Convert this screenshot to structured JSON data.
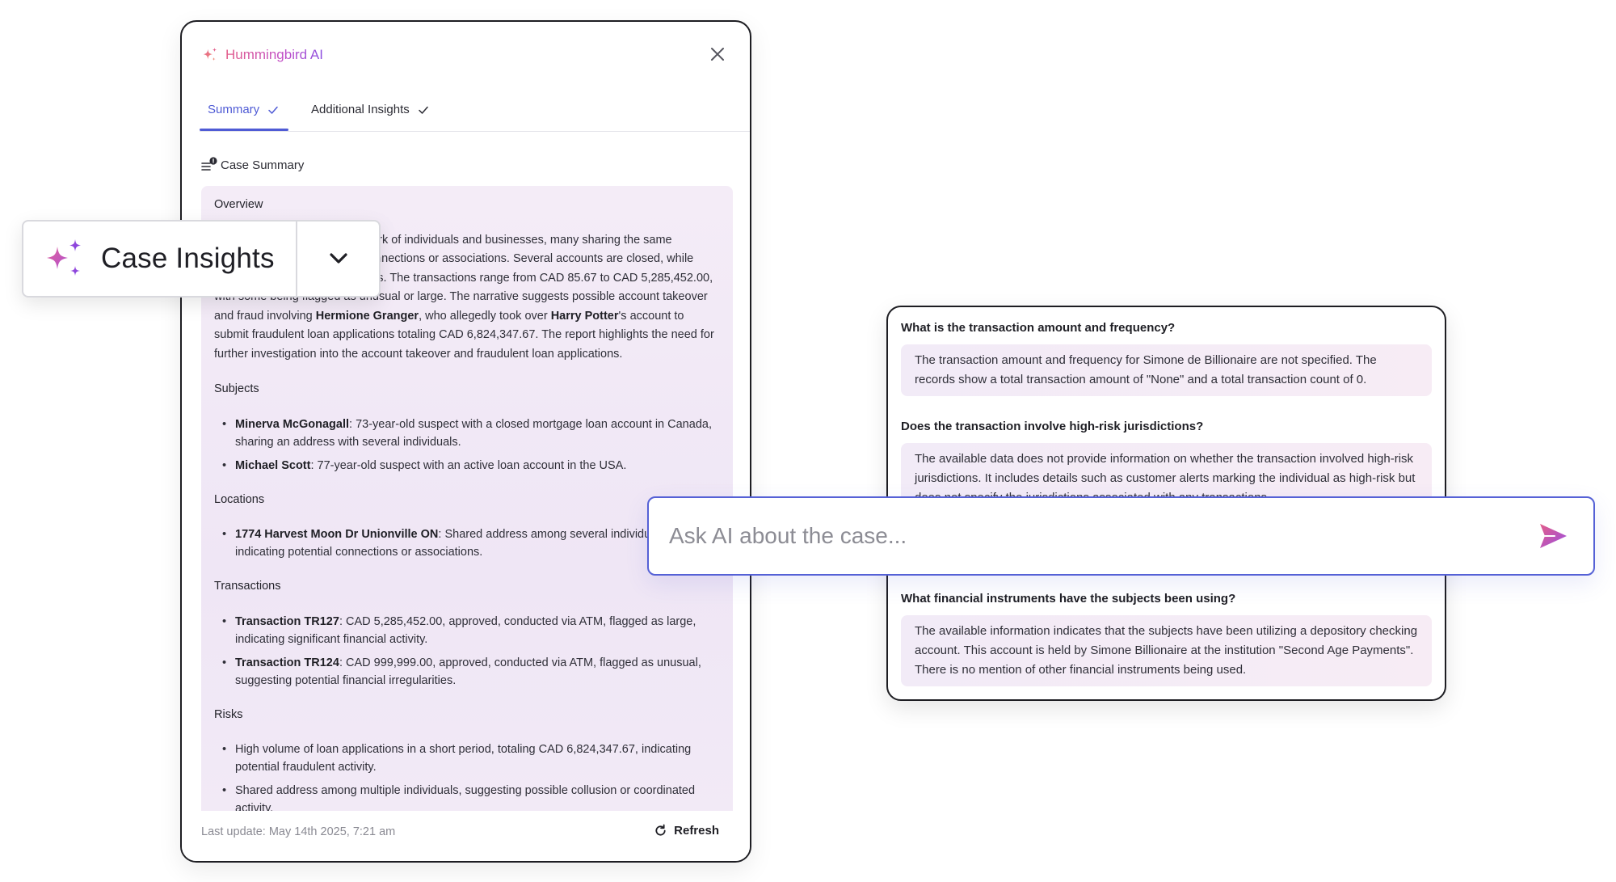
{
  "summary_panel": {
    "brand": "Hummingbird AI",
    "brand_icon": "sparkle-icon",
    "tabs": [
      {
        "label": "Summary",
        "active": true
      },
      {
        "label": "Additional Insights",
        "active": false
      }
    ],
    "section_header": "Case Summary",
    "overview_title": "Overview",
    "overview_text": "The case data involves a network of individuals and businesses, many sharing the same address, indicating potential connections or associations. Several accounts are closed, while others show suspicious activities. The transactions range from CAD 85.67 to CAD 5,285,452.00, with some being flagged as unusual or large. The narrative suggests possible account takeover and fraud involving ",
    "overview_name_1": "Hermione Granger",
    "overview_mid": ", who allegedly took over ",
    "overview_name_2": "Harry Potter",
    "overview_tail": "'s account to submit fraudulent loan applications totaling CAD 6,824,347.67. The report highlights the need for further investigation into the account takeover and fraudulent loan applications.",
    "subjects_title": "Subjects",
    "subjects": [
      {
        "name": "Minerva McGonagall",
        "desc": ": 73-year-old suspect with a closed mortgage loan account in Canada, sharing an address with several individuals."
      },
      {
        "name": "Michael Scott",
        "desc": ": 77-year-old suspect with an active loan account in the USA."
      }
    ],
    "locations_title": "Locations",
    "locations": [
      {
        "name": "1774 Harvest Moon Dr Unionville ON",
        "desc": ": Shared address among several individuals, indicating potential connections or associations."
      }
    ],
    "transactions_title": "Transactions",
    "transactions": [
      {
        "name": "Transaction TR127",
        "desc": ": CAD 5,285,452.00, approved, conducted via ATM, flagged as large, indicating significant financial activity."
      },
      {
        "name": "Transaction TR124",
        "desc": ": CAD 999,999.00, approved, conducted via ATM, flagged as unusual, suggesting potential financial irregularities."
      }
    ],
    "risks_title": "Risks",
    "risks": [
      "High volume of loan applications in a short period, totaling CAD 6,824,347.67, indicating potential fraudulent activity.",
      "Shared address among multiple individuals, suggesting possible collusion or coordinated activity."
    ],
    "last_update": "Last update: May 14th 2025, 7:21 am",
    "refresh_label": "Refresh"
  },
  "insights_button": {
    "label": "Case Insights",
    "icon": "sparkles-icon"
  },
  "qa_panel": {
    "items": [
      {
        "question": "What is the transaction amount and frequency?",
        "answer": "The transaction amount and frequency for Simone de Billionaire are not specified. The records show a total transaction amount of \"None\" and a total transaction count of 0."
      },
      {
        "question": "Does the transaction involve high-risk jurisdictions?",
        "answer": "The available data does not provide information on whether the transaction involved high-risk jurisdictions. It includes details such as customer alerts marking the individual as high-risk but does not specify the jurisdictions associated with any transactions."
      },
      {
        "question": "What financial instruments have the subjects been using?",
        "answer": "The available information indicates that the subjects have been utilizing a depository checking account. This account is held by Simone Billionaire at the institution \"Second Age Payments\". There is no mention of other financial instruments being used."
      }
    ]
  },
  "ask_bar": {
    "placeholder": "Ask AI about the case...",
    "send_icon": "send-icon"
  },
  "colors": {
    "accent": "#4f5bd5",
    "brand_pink": "#e35d8a",
    "brand_purple": "#8c4fe0",
    "answer_bg": "#f2ebf7"
  }
}
